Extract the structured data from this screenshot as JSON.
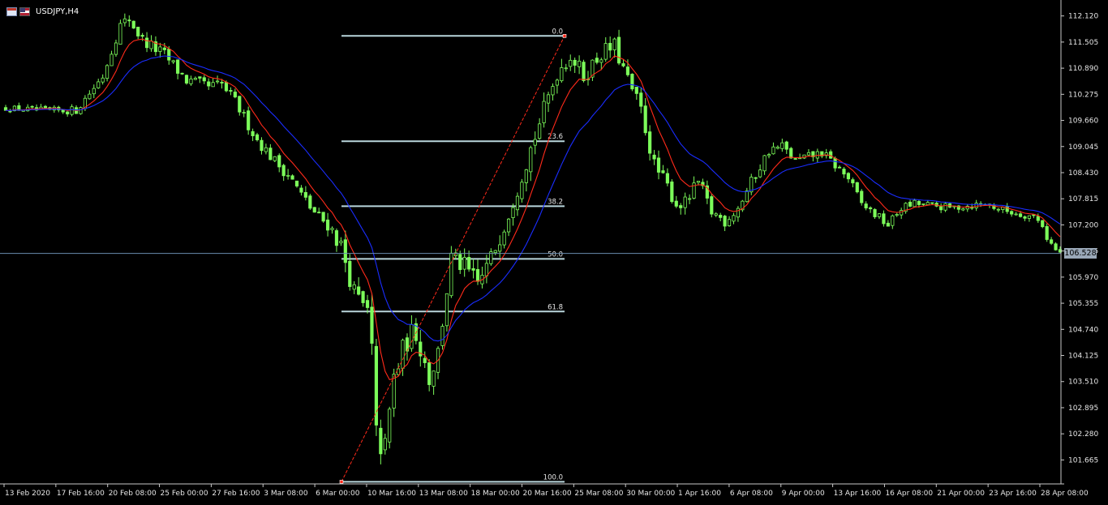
{
  "window": {
    "symbol_title": "USDJPY,H4"
  },
  "icons": {
    "chart_icon": "calendar-icon",
    "flag_icon": "us-flag-icon"
  },
  "colors": {
    "background": "#000000",
    "bull_candle": "#7cfc5a",
    "bear_candle": "#7cfc5a",
    "ma_fast": "#ff2a1a",
    "ma_slow": "#1a2dff",
    "fib_line": "#b9d6dc",
    "current_price_line": "#6a8caf",
    "axis_text": "#e6e6e6"
  },
  "current_price": "106.528",
  "chart_data": {
    "type": "candlestick",
    "title": "USDJPY,H4",
    "ylim": [
      101.1,
      112.4
    ],
    "y_ticks": [
      "112.120",
      "111.505",
      "110.890",
      "110.275",
      "109.660",
      "109.045",
      "108.430",
      "107.815",
      "107.200",
      "106.585",
      "105.970",
      "105.355",
      "104.740",
      "104.125",
      "103.510",
      "102.895",
      "102.280",
      "101.665"
    ],
    "x_ticks": [
      "13 Feb 2020",
      "17 Feb 16:00",
      "20 Feb 08:00",
      "25 Feb 00:00",
      "27 Feb 16:00",
      "3 Mar 08:00",
      "6 Mar 00:00",
      "10 Mar 16:00",
      "13 Mar 08:00",
      "18 Mar 00:00",
      "20 Mar 16:00",
      "25 Mar 08:00",
      "30 Mar 00:00",
      "1 Apr 16:00",
      "6 Apr 08:00",
      "9 Apr 00:00",
      "13 Apr 16:00",
      "16 Apr 08:00",
      "21 Apr 00:00",
      "23 Apr 16:00",
      "28 Apr 08:00"
    ],
    "close_path": [
      [
        0,
        109.95
      ],
      [
        10,
        109.88
      ],
      [
        16,
        109.9
      ],
      [
        22,
        110.7
      ],
      [
        26,
        111.9
      ],
      [
        28,
        112.05
      ],
      [
        31,
        111.55
      ],
      [
        36,
        111.2
      ],
      [
        41,
        110.6
      ],
      [
        46,
        110.45
      ],
      [
        49,
        110.5
      ],
      [
        52,
        110.1
      ],
      [
        57,
        109.2
      ],
      [
        61,
        108.7
      ],
      [
        64,
        108.4
      ],
      [
        67,
        107.9
      ],
      [
        71,
        107.35
      ],
      [
        73,
        107.25
      ],
      [
        76,
        106.7
      ],
      [
        79,
        105.6
      ],
      [
        82,
        105.1
      ],
      [
        83,
        104.2
      ],
      [
        84,
        102.2
      ],
      [
        86,
        101.9
      ],
      [
        88,
        103.6
      ],
      [
        91,
        104.5
      ],
      [
        93,
        104.7
      ],
      [
        96,
        103.6
      ],
      [
        98,
        104.2
      ],
      [
        101,
        106.4
      ],
      [
        104,
        106.2
      ],
      [
        107,
        105.8
      ],
      [
        110,
        106.4
      ],
      [
        114,
        107.5
      ],
      [
        117,
        108.4
      ],
      [
        121,
        109.6
      ],
      [
        125,
        110.8
      ],
      [
        128,
        111.2
      ],
      [
        131,
        110.7
      ],
      [
        135,
        111.25
      ],
      [
        138,
        111.4
      ],
      [
        141,
        110.6
      ],
      [
        144,
        109.9
      ],
      [
        147,
        108.6
      ],
      [
        150,
        108.1
      ],
      [
        152,
        107.7
      ],
      [
        154,
        107.7
      ],
      [
        157,
        108.2
      ],
      [
        160,
        107.5
      ],
      [
        163,
        107.3
      ],
      [
        166,
        107.6
      ],
      [
        169,
        108.2
      ],
      [
        173,
        108.95
      ],
      [
        176,
        109.05
      ],
      [
        179,
        108.7
      ],
      [
        182,
        108.8
      ],
      [
        185,
        108.9
      ],
      [
        188,
        108.6
      ],
      [
        191,
        108.3
      ],
      [
        194,
        107.7
      ],
      [
        197,
        107.45
      ],
      [
        200,
        107.2
      ],
      [
        203,
        107.6
      ],
      [
        206,
        107.7
      ],
      [
        210,
        107.65
      ],
      [
        214,
        107.6
      ],
      [
        218,
        107.65
      ],
      [
        222,
        107.7
      ],
      [
        226,
        107.55
      ],
      [
        230,
        107.45
      ],
      [
        233,
        107.4
      ],
      [
        235,
        107.2
      ],
      [
        236,
        106.9
      ],
      [
        238,
        106.6
      ],
      [
        239,
        106.53
      ]
    ],
    "range_path": [
      [
        0,
        0.15
      ],
      [
        24,
        0.25
      ],
      [
        30,
        0.35
      ],
      [
        60,
        0.3
      ],
      [
        80,
        0.55
      ],
      [
        84,
        0.85
      ],
      [
        90,
        0.7
      ],
      [
        100,
        0.55
      ],
      [
        118,
        0.5
      ],
      [
        135,
        0.45
      ],
      [
        150,
        0.4
      ],
      [
        170,
        0.3
      ],
      [
        200,
        0.22
      ],
      [
        239,
        0.18
      ]
    ],
    "candle_count": 240,
    "overlays": [
      {
        "name": "",
        "kind": "moving-average",
        "color": "#ff2a1a"
      },
      {
        "name": "",
        "kind": "moving-average",
        "color": "#1a2dff"
      }
    ],
    "fibonacci": {
      "anchor_low": 101.15,
      "anchor_high": 111.65,
      "levels": [
        {
          "label": "0.0",
          "price": 111.65
        },
        {
          "label": "23.6",
          "price": 109.17
        },
        {
          "label": "38.2",
          "price": 107.64
        },
        {
          "label": "50.0",
          "price": 106.4
        },
        {
          "label": "61.8",
          "price": 105.16
        },
        {
          "label": "100.0",
          "price": 101.15
        }
      ]
    },
    "grid": false,
    "legend": "none"
  }
}
